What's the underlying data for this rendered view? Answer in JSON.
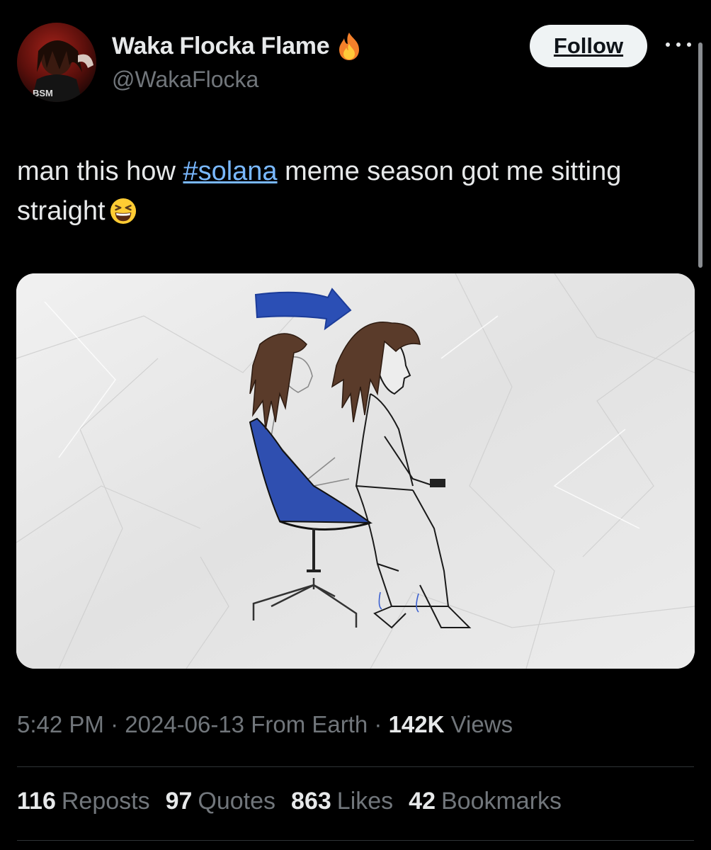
{
  "user": {
    "display_name": "Waka Flocka Flame",
    "handle": "@WakaFlocka",
    "badge_icon": "fire-emoji",
    "avatar_badge_text": "BSM"
  },
  "header": {
    "follow_label": "Follow",
    "more_icon": "more-horizontal-icon"
  },
  "tweet": {
    "text_before": "man this how ",
    "hashtag": "#solana",
    "text_after": " meme season got me sitting straight",
    "emoji": "grinning-squinting-face-emoji"
  },
  "meta": {
    "time": "5:42 PM",
    "sep1": " · ",
    "date": "2024-06-13",
    "location": " From Earth",
    "sep2": " · ",
    "views_count": "142K",
    "views_label": " Views"
  },
  "stats": [
    {
      "count": "116",
      "label": "Reposts"
    },
    {
      "count": "97",
      "label": "Quotes"
    },
    {
      "count": "863",
      "label": "Likes"
    },
    {
      "count": "42",
      "label": "Bookmarks"
    }
  ],
  "colors": {
    "background": "#000000",
    "text": "#e7e9ea",
    "secondary": "#71767b",
    "hashtag": "#79b8ff",
    "follow_button": "#eff3f4",
    "chair": "#2f4fb0"
  }
}
